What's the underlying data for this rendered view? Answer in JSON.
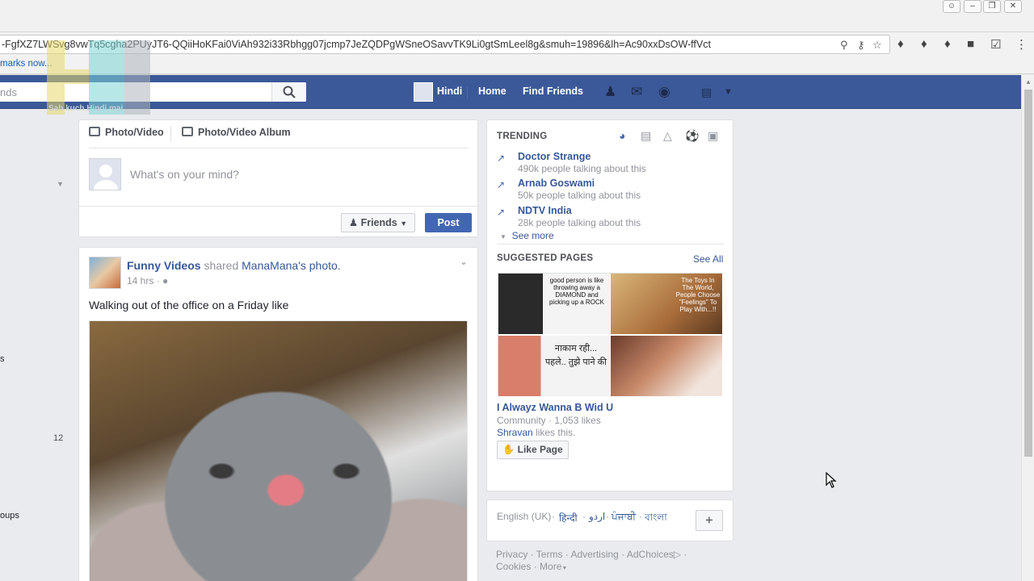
{
  "browser": {
    "url": "-FgfXZ7LWSvg8vwTq5cgha2PUyJT6-QQiiHoKFai0ViAh932i33Rbhgg07jcmp7JeZQDPgWSneOSavvTK9Li0gtSmLeel8g&smuh=19896&lh=Ac90xxDsOW-ffVct",
    "bookmarks_text": "marks now..."
  },
  "watermark": {
    "letters": "HM",
    "tagline": "Sab kuch Hindi mai"
  },
  "fbbar": {
    "search_text": "nds",
    "profile_name": "Hindi",
    "home": "Home",
    "find_friends": "Find Friends"
  },
  "left_fragments": {
    "s": "s",
    "count": "12",
    "groups": "oups"
  },
  "composer": {
    "photo_video": "Photo/Video",
    "photo_album": "Photo/Video Album",
    "placeholder": "What's on your mind?",
    "audience": "Friends",
    "post": "Post"
  },
  "post": {
    "author": "Funny Videos",
    "shared": "shared",
    "page": "ManaMana",
    "possessive_photo": "'s photo.",
    "time": "14 hrs",
    "text": "Walking out of the office on a Friday like"
  },
  "trending": {
    "title": "TRENDING",
    "items": [
      {
        "name": "Doctor Strange",
        "sub": "490k people talking about this"
      },
      {
        "name": "Arnab Goswami",
        "sub": "50k people talking about this"
      },
      {
        "name": "NDTV India",
        "sub": "28k people talking about this"
      }
    ],
    "see_more": "See more"
  },
  "suggested": {
    "title": "SUGGESTED PAGES",
    "see_all": "See All",
    "img_text_1": "good person is like throwing away a DIAMOND and picking up a ROCK",
    "img_text_2": "The Toys In The World, People Choose \"Feelings\" To Play With...!!",
    "img_text_3": "नाकाम रही... पहले.. तुझे पाने की",
    "page_name": "I Alwayz Wanna B Wid U",
    "page_meta": "Community · 1,053 likes",
    "friend": "Shravan",
    "likes_this": "likes this.",
    "like_page": "Like Page"
  },
  "language": {
    "current": "English (UK)",
    "options": [
      "हिन्दी",
      "اردو",
      "ਪੰਜਾਬੀ",
      "বাংলা"
    ],
    "add": "+"
  },
  "footer": {
    "links": [
      "Privacy",
      "Terms",
      "Advertising",
      "AdChoices",
      "Cookies",
      "More"
    ]
  }
}
